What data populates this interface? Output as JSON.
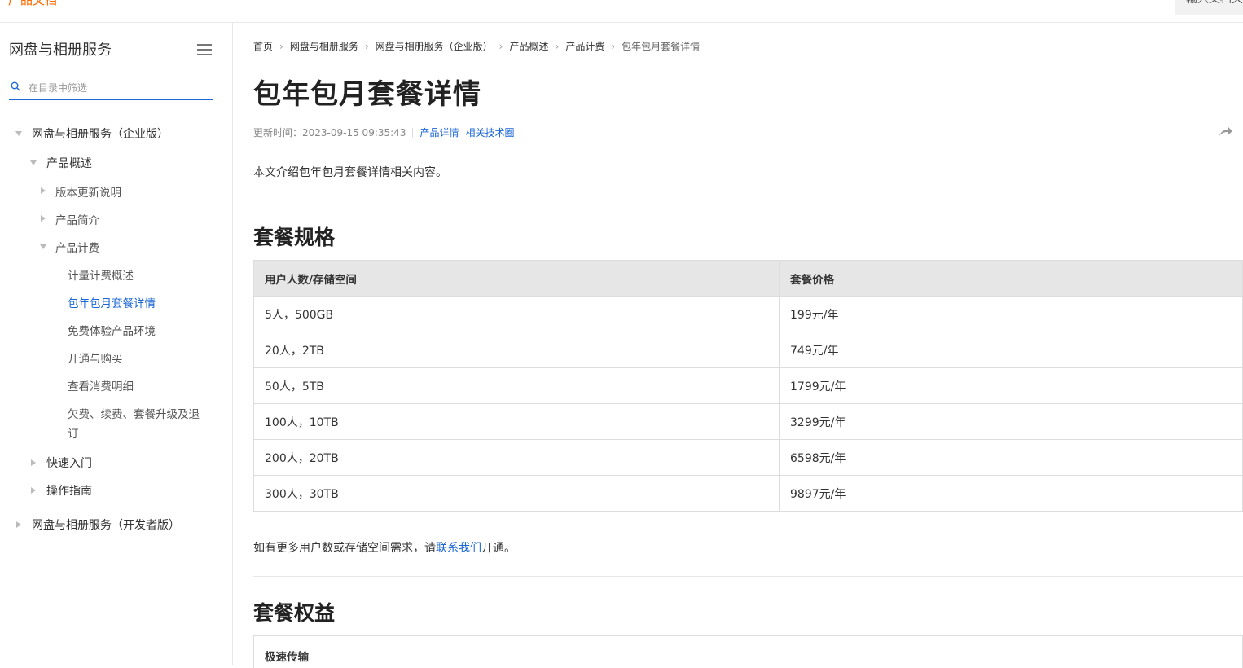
{
  "topbar": {
    "title": "产品文档",
    "search_text": "输入文档关"
  },
  "sidebar": {
    "title": "网盘与相册服务",
    "filter_placeholder": "在目录中筛选",
    "tree": [
      {
        "label": "网盘与相册服务（企业版）",
        "state": "expanded"
      },
      {
        "label": "产品概述",
        "state": "expanded"
      },
      {
        "label": "版本更新说明",
        "state": "collapsed"
      },
      {
        "label": "产品简介",
        "state": "collapsed"
      },
      {
        "label": "产品计费",
        "state": "expanded"
      },
      {
        "label": "计量计费概述",
        "state": "leaf"
      },
      {
        "label": "包年包月套餐详情",
        "state": "leaf-active"
      },
      {
        "label": "免费体验产品环境",
        "state": "leaf"
      },
      {
        "label": "开通与购买",
        "state": "leaf"
      },
      {
        "label": "查看消费明细",
        "state": "leaf"
      },
      {
        "label": "欠费、续费、套餐升级及退",
        "label_line2": "订",
        "state": "leaf"
      },
      {
        "label": "快速入门",
        "state": "collapsed"
      },
      {
        "label": "操作指南",
        "state": "collapsed"
      },
      {
        "label": "网盘与相册服务（开发者版）",
        "state": "collapsed"
      }
    ]
  },
  "breadcrumb": [
    "首页",
    "网盘与相册服务",
    "网盘与相册服务（企业版）",
    "产品概述",
    "产品计费",
    "包年包月套餐详情"
  ],
  "page": {
    "title": "包年包月套餐详情",
    "updated_label": "更新时间：2023-09-15 09:35:43",
    "links": [
      "产品详情",
      "相关技术圈"
    ],
    "intro": "本文介绍包年包月套餐详情相关内容。",
    "section1_title": "套餐规格",
    "table": {
      "headers": [
        "用户人数/存储空间",
        "套餐价格"
      ],
      "rows": [
        [
          "5人，500GB",
          "199元/年"
        ],
        [
          "20人，2TB",
          "749元/年"
        ],
        [
          "50人，5TB",
          "1799元/年"
        ],
        [
          "100人，10TB",
          "3299元/年"
        ],
        [
          "200人，20TB",
          "6598元/年"
        ],
        [
          "300人，30TB",
          "9897元/年"
        ]
      ]
    },
    "note_prefix": "如有更多用户数或存储空间需求，请",
    "note_link": "联系我们",
    "note_suffix": "开通。",
    "section2_title": "套餐权益",
    "section2_box_title": "极速传输"
  },
  "colors": {
    "accent": "#1a66d6",
    "brand_orange": "#ff6a00",
    "header_bg": "#e6e6e6"
  }
}
